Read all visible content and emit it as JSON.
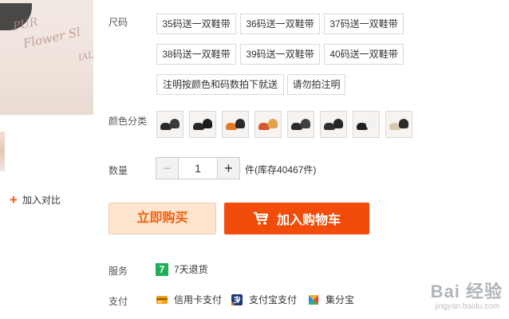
{
  "product_image": {
    "box_text": [
      "PUR",
      "Flower Sl",
      "IAL"
    ]
  },
  "compare": {
    "label": "加入对比"
  },
  "size": {
    "label": "尺码",
    "options": [
      "35码送一双鞋带",
      "36码送一双鞋带",
      "37码送一双鞋带",
      "38码送一双鞋带",
      "39码送一双鞋带",
      "40码送一双鞋带",
      "注明按颜色和码数拍下就送",
      "请勿拍注明"
    ]
  },
  "color": {
    "label": "颜色分类",
    "swatches": [
      {
        "name": "black-white",
        "colors": [
          "#2a2a2a",
          "#3a3a3a"
        ]
      },
      {
        "name": "black",
        "colors": [
          "#262626",
          "#1c1c1c"
        ]
      },
      {
        "name": "orange",
        "colors": [
          "#e07b2a",
          "#2a2a2a"
        ]
      },
      {
        "name": "red-orange",
        "colors": [
          "#d8562f",
          "#e3a24d"
        ]
      },
      {
        "name": "black-2",
        "colors": [
          "#2b2b2b",
          "#404040"
        ]
      },
      {
        "name": "black-3",
        "colors": [
          "#303030",
          "#252525"
        ]
      },
      {
        "name": "black-white-2",
        "colors": [
          "#202020",
          "#f1f1f1"
        ]
      },
      {
        "name": "beige-black",
        "colors": [
          "#d8c8b2",
          "#2c2c2c"
        ]
      }
    ]
  },
  "quantity": {
    "label": "数量",
    "value": "1",
    "minus": "−",
    "plus": "+",
    "stock_text": "件(库存40467件)"
  },
  "actions": {
    "buy_now": "立即购买",
    "add_cart": "加入购物车"
  },
  "service": {
    "label": "服务",
    "items": [
      {
        "icon": "seven-day-return-icon",
        "text": "7天退货"
      }
    ]
  },
  "payment": {
    "label": "支付",
    "items": [
      {
        "icon": "credit-card-icon",
        "text": "信用卡支付"
      },
      {
        "icon": "alipay-icon",
        "text": "支付宝支付"
      },
      {
        "icon": "points-icon",
        "text": "集分宝"
      }
    ]
  },
  "watermark": {
    "main": "Bai 经验",
    "sub": "jingyan.baidu.com"
  },
  "colors": {
    "accent": "#f24c0a",
    "accent_light": "#ffe4d0",
    "green": "#1fae5a"
  }
}
